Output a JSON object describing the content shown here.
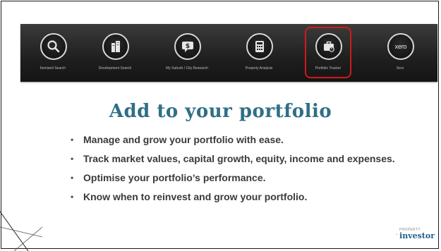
{
  "slide": {
    "title": "Add to your portfolio",
    "bullets": [
      "Manage and grow your portfolio with ease.",
      "Track market values, capital growth, equity, income and expenses.",
      "Optimise your portfolio’s performance.",
      "Know when to reinvest and grow your portfolio."
    ]
  },
  "nav": {
    "items": [
      {
        "label": "Itemised Search",
        "icon": "search-icon"
      },
      {
        "label": "Development Search",
        "icon": "buildings-icon"
      },
      {
        "label": "My Suburb / City Research",
        "icon": "money-chat-icon"
      },
      {
        "label": "Property Analysis",
        "icon": "calculator-icon"
      },
      {
        "label": "Portfolio Tracker",
        "icon": "briefcase-icon",
        "highlighted": true
      },
      {
        "label": "Xero",
        "icon": "xero-icon",
        "text": "xero"
      }
    ],
    "highlight_color": "#d11a1a"
  },
  "logo": {
    "small_text": "PROPERTY",
    "big_text": "investor"
  },
  "colors": {
    "title": "#2f6f86",
    "banner": "#1f1f1f",
    "logo": "#1f5f8b"
  }
}
